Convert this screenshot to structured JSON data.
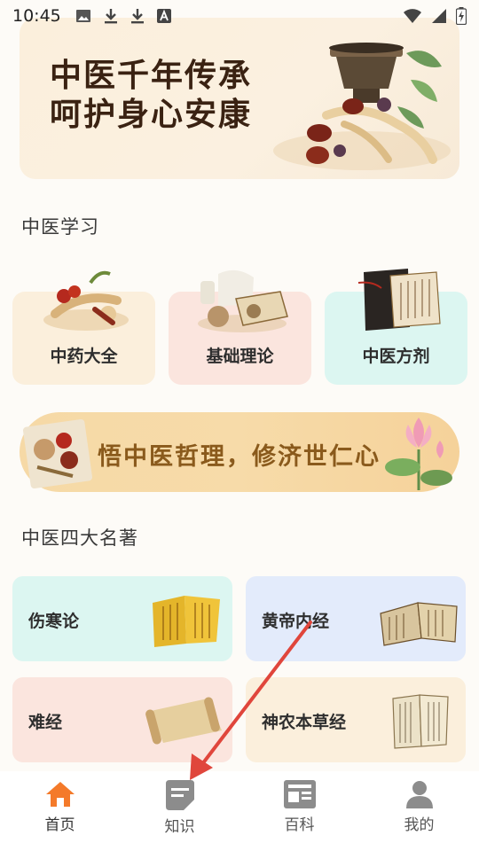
{
  "status_bar": {
    "time": "10:45"
  },
  "banner": {
    "line1": "中医千年传承",
    "line2": "呵护身心安康"
  },
  "study": {
    "title": "中医学习",
    "cards": [
      {
        "label": "中药大全",
        "bg": "#fbefdc"
      },
      {
        "label": "基础理论",
        "bg": "#fbe5de"
      },
      {
        "label": "中医方剂",
        "bg": "#dcf6f1"
      }
    ]
  },
  "slogan": {
    "text": "悟中医哲理，修济世仁心"
  },
  "classics": {
    "title": "中医四大名著",
    "cards": [
      {
        "label": "伤寒论",
        "bg": "#dcf6f1"
      },
      {
        "label": "黄帝内经",
        "bg": "#e3ebfb"
      },
      {
        "label": "难经",
        "bg": "#fbe5de"
      },
      {
        "label": "神农本草经",
        "bg": "#fbefdc"
      }
    ]
  },
  "bottom_nav": {
    "items": [
      {
        "label": "首页",
        "icon": "home-icon",
        "active": true
      },
      {
        "label": "知识",
        "icon": "knowledge-icon",
        "active": false
      },
      {
        "label": "百科",
        "icon": "encyclopedia-icon",
        "active": false
      },
      {
        "label": "我的",
        "icon": "profile-icon",
        "active": false
      }
    ]
  },
  "colors": {
    "accent": "#f47a2a",
    "nav_icon_inactive": "#8c8c8c",
    "arrow": "#e0463c"
  }
}
